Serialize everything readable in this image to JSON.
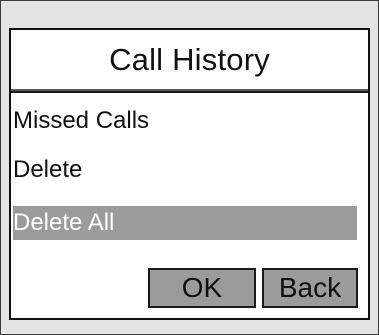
{
  "screen": {
    "title": "Call History",
    "menu": {
      "items": [
        {
          "label": "Missed Calls",
          "selected": false
        },
        {
          "label": "Delete",
          "selected": false
        },
        {
          "label": "Delete All",
          "selected": true
        }
      ]
    },
    "softkeys": {
      "ok_label": "OK",
      "back_label": "Back"
    }
  },
  "colors": {
    "bezel": "#e4e4e4",
    "screen_background": "#ffffff",
    "highlight": "#9b9b9b",
    "text": "#111111"
  }
}
